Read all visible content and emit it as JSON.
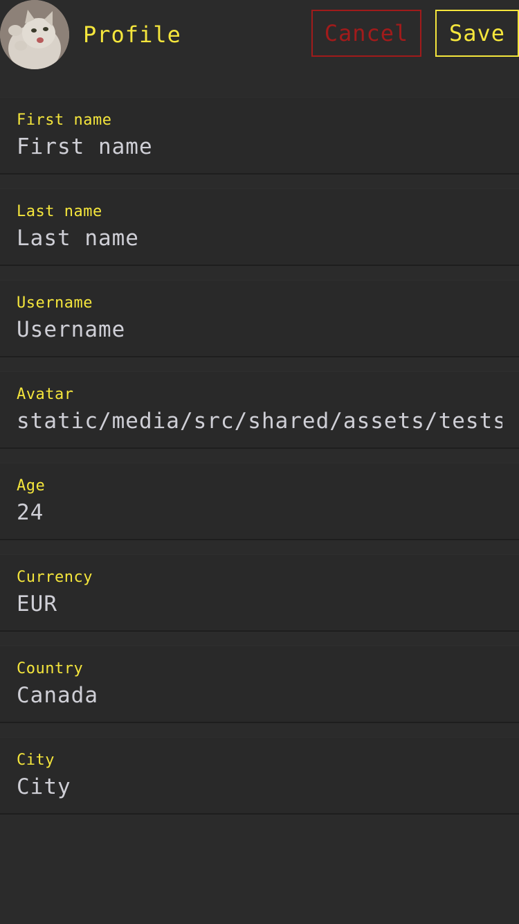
{
  "colors": {
    "background": "#2b2b2b",
    "accent": "#f5e63c",
    "danger": "#a11b1b",
    "text": "#cfcfd6"
  },
  "header": {
    "title": "Profile",
    "cancel_label": "Cancel",
    "save_label": "Save",
    "avatar_icon": "cat-photo-avatar"
  },
  "fields": [
    {
      "label": "First name",
      "value": "First name"
    },
    {
      "label": "Last name",
      "value": "Last name"
    },
    {
      "label": "Username",
      "value": "Username"
    },
    {
      "label": "Avatar",
      "value": "static/media/src/shared/assets/tests/"
    },
    {
      "label": "Age",
      "value": "24"
    },
    {
      "label": "Currency",
      "value": "EUR"
    },
    {
      "label": "Country",
      "value": "Canada"
    },
    {
      "label": "City",
      "value": "City"
    }
  ]
}
